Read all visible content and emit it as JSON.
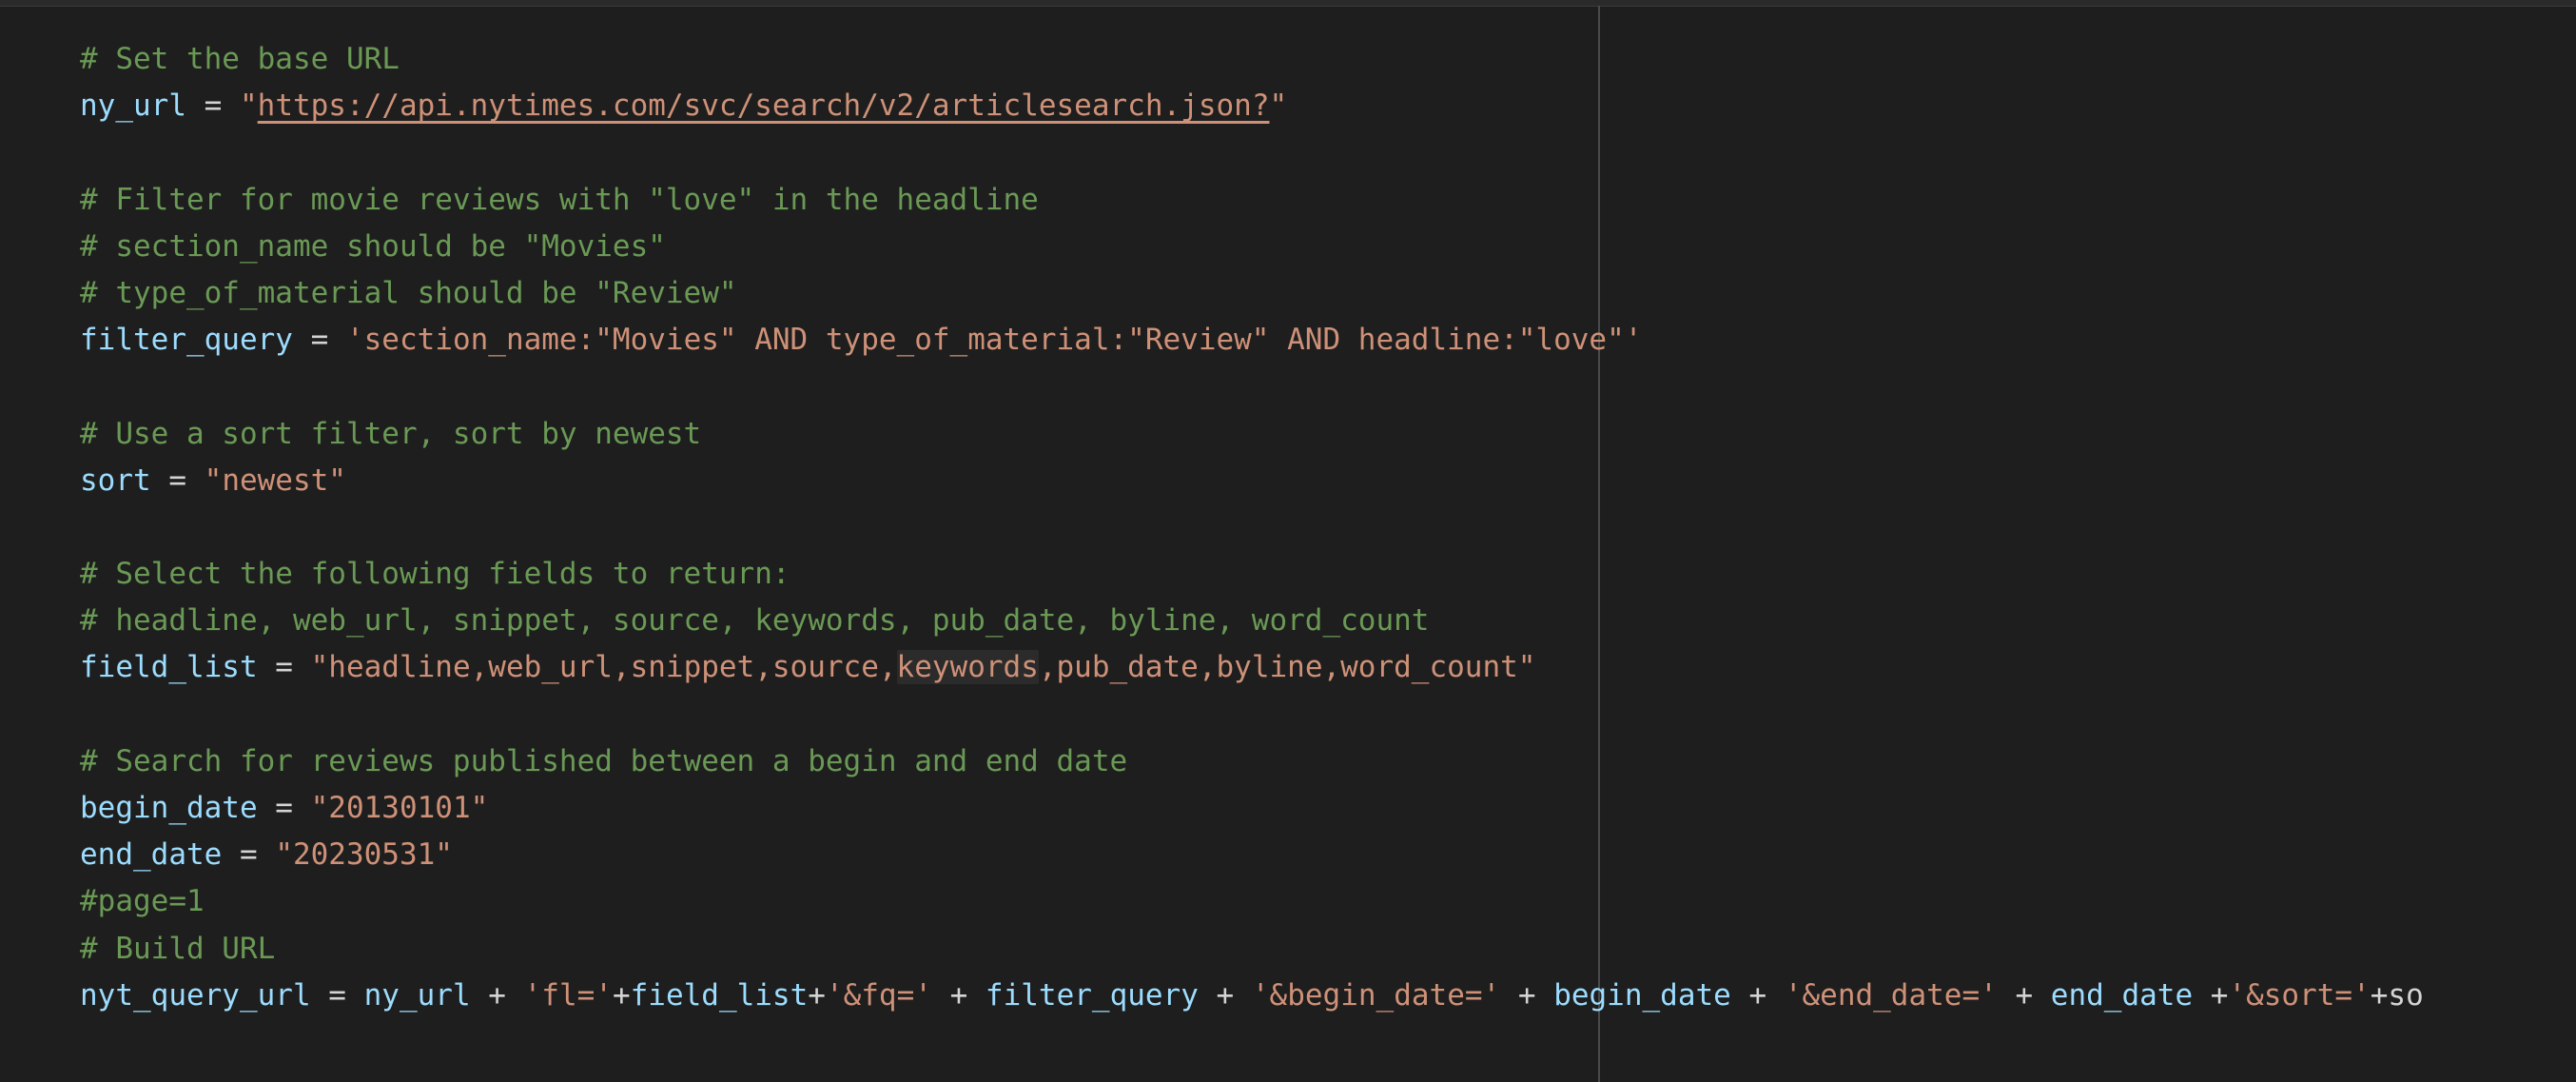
{
  "editor": {
    "lines": [
      {
        "tokens": [
          {
            "t": "# Set the base URL",
            "k": "c"
          }
        ]
      },
      {
        "tokens": [
          {
            "t": "ny_url",
            "k": "v"
          },
          {
            "t": " = ",
            "k": "o"
          },
          {
            "t": "\"",
            "k": "s"
          },
          {
            "t": "https://api.nytimes.com/svc/search/v2/articlesearch.json?",
            "k": "u"
          },
          {
            "t": "\"",
            "k": "s"
          }
        ]
      },
      {
        "tokens": []
      },
      {
        "tokens": [
          {
            "t": "# Filter for movie reviews with \"love\" in the headline",
            "k": "c"
          }
        ]
      },
      {
        "tokens": [
          {
            "t": "# section_name should be \"Movies\"",
            "k": "c"
          }
        ]
      },
      {
        "tokens": [
          {
            "t": "# type_of_material should be \"Review\"",
            "k": "c"
          }
        ]
      },
      {
        "tokens": [
          {
            "t": "filter_query",
            "k": "v"
          },
          {
            "t": " = ",
            "k": "o"
          },
          {
            "t": "'section_name:\"Movies\" AND type_of_material:\"Review\" AND headline:\"love\"'",
            "k": "s"
          }
        ]
      },
      {
        "tokens": []
      },
      {
        "tokens": [
          {
            "t": "# Use a sort filter, sort by newest",
            "k": "c"
          }
        ]
      },
      {
        "tokens": [
          {
            "t": "sort",
            "k": "v"
          },
          {
            "t": " = ",
            "k": "o"
          },
          {
            "t": "\"newest\"",
            "k": "s"
          }
        ]
      },
      {
        "tokens": []
      },
      {
        "tokens": [
          {
            "t": "# Select the following fields to return:",
            "k": "c"
          }
        ]
      },
      {
        "tokens": [
          {
            "t": "# headline, web_url, snippet, source, keywords, pub_date, byline, word_count",
            "k": "c"
          }
        ]
      },
      {
        "tokens": [
          {
            "t": "field_list",
            "k": "v"
          },
          {
            "t": " = ",
            "k": "o"
          },
          {
            "t": "\"headline,web_url,snippet,source,",
            "k": "s"
          },
          {
            "t": "keywords",
            "k": "s",
            "hl": true
          },
          {
            "t": ",pub_date,byline,word_count\"",
            "k": "s"
          }
        ]
      },
      {
        "tokens": []
      },
      {
        "tokens": [
          {
            "t": "# Search for reviews published between a begin and end date",
            "k": "c"
          }
        ]
      },
      {
        "tokens": [
          {
            "t": "begin_date",
            "k": "v"
          },
          {
            "t": " = ",
            "k": "o"
          },
          {
            "t": "\"20130101\"",
            "k": "s"
          }
        ]
      },
      {
        "tokens": [
          {
            "t": "end_date",
            "k": "v"
          },
          {
            "t": " = ",
            "k": "o"
          },
          {
            "t": "\"20230531\"",
            "k": "s"
          }
        ]
      },
      {
        "tokens": [
          {
            "t": "#page=1",
            "k": "c"
          }
        ]
      },
      {
        "tokens": [
          {
            "t": "# Build URL",
            "k": "c"
          }
        ]
      },
      {
        "tokens": [
          {
            "t": "nyt_query_url",
            "k": "v"
          },
          {
            "t": " = ",
            "k": "o"
          },
          {
            "t": "ny_url",
            "k": "v"
          },
          {
            "t": " + ",
            "k": "o"
          },
          {
            "t": "'fl='",
            "k": "s"
          },
          {
            "t": "+",
            "k": "o"
          },
          {
            "t": "field_list",
            "k": "v"
          },
          {
            "t": "+",
            "k": "o"
          },
          {
            "t": "'&fq='",
            "k": "s"
          },
          {
            "t": " + ",
            "k": "o"
          },
          {
            "t": "filter_query",
            "k": "v"
          },
          {
            "t": " + ",
            "k": "o"
          },
          {
            "t": "'&begin_date='",
            "k": "s"
          },
          {
            "t": " + ",
            "k": "o"
          },
          {
            "t": "begin_date",
            "k": "v"
          },
          {
            "t": " + ",
            "k": "o"
          },
          {
            "t": "'&end_date='",
            "k": "s"
          },
          {
            "t": " + ",
            "k": "o"
          },
          {
            "t": "end_date",
            "k": "v"
          },
          {
            "t": " +",
            "k": "o"
          },
          {
            "t": "'&sort='",
            "k": "s"
          },
          {
            "t": "+so",
            "k": "o"
          }
        ]
      }
    ]
  },
  "colors": {
    "background": "#1e1e1e",
    "comment": "#6a9955",
    "variable": "#9cdcfe",
    "string": "#ce9178",
    "operator": "#d4d4d4"
  }
}
